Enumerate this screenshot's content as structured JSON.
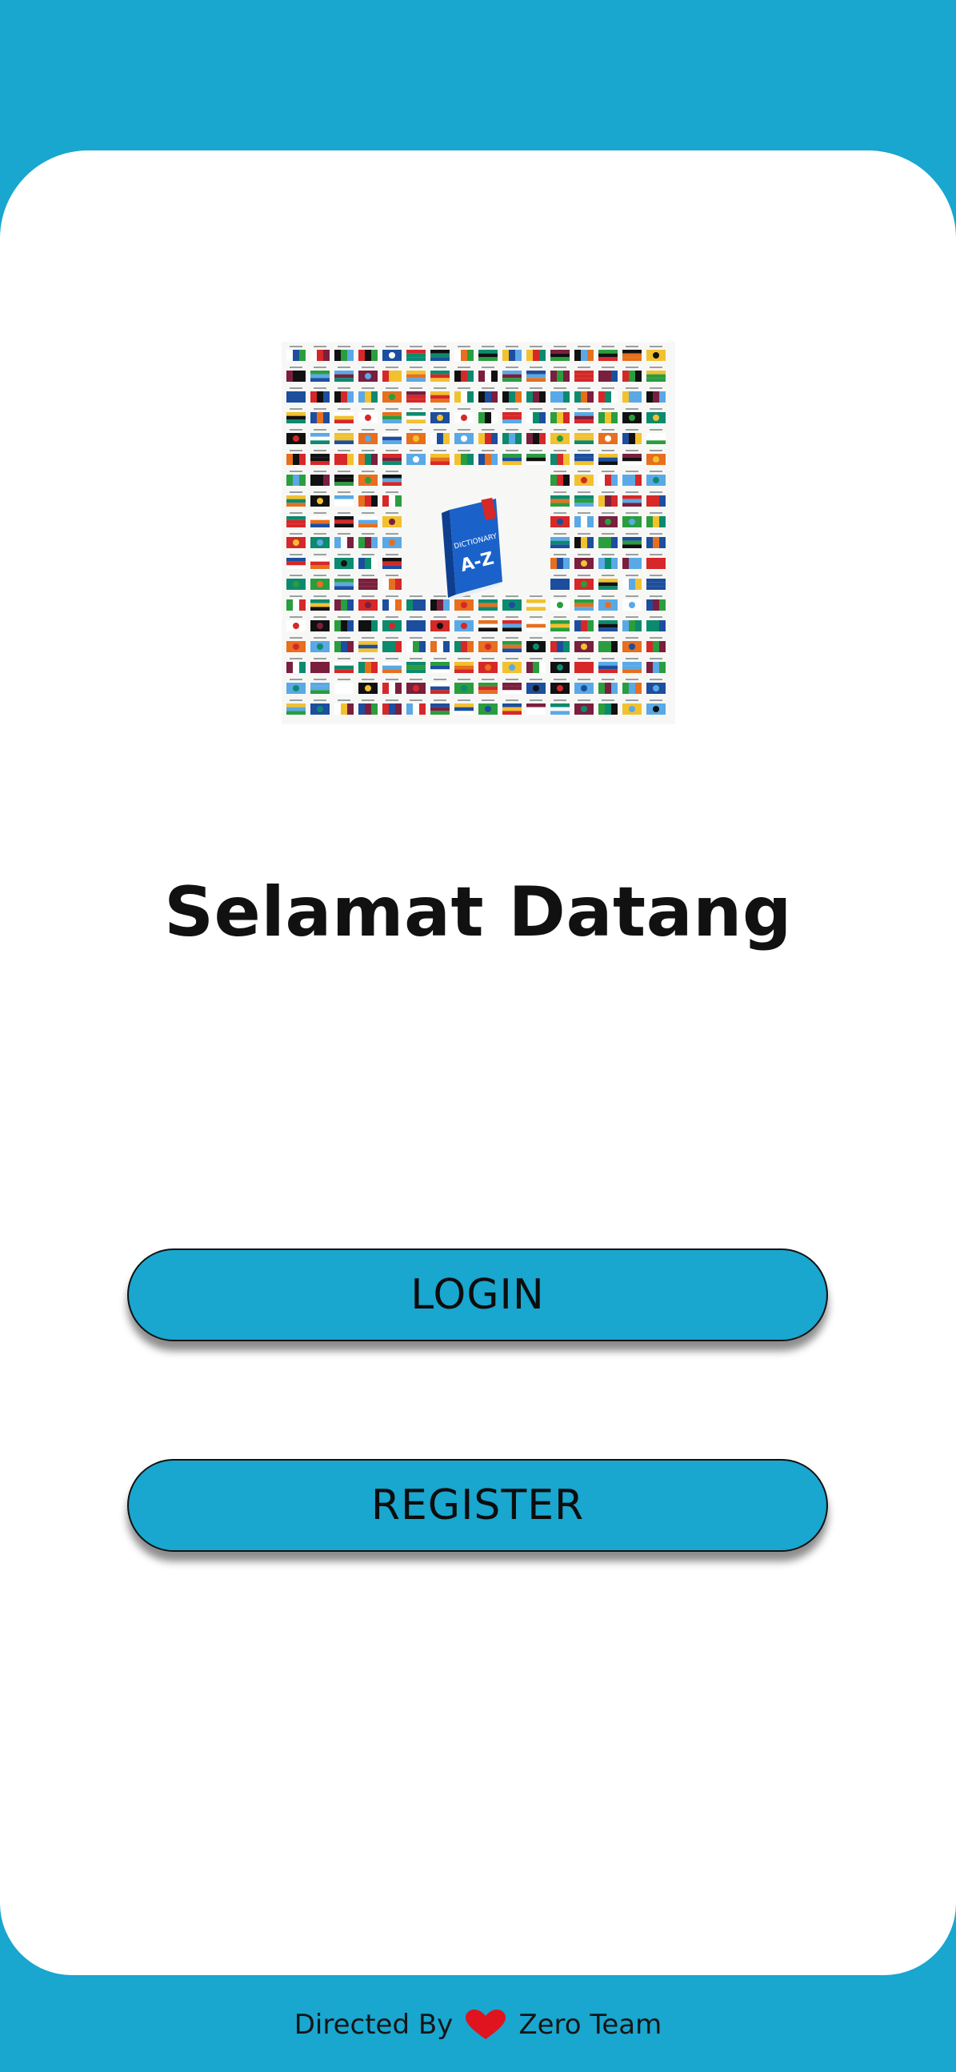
{
  "hero": {
    "image_name": "world-flags-dictionary-illustration",
    "book_label": "DICTIONARY",
    "book_title": "A-Z",
    "flag_colors": [
      "#d62828",
      "#1d4e9e",
      "#2a9d3f",
      "#f2c12e",
      "#111111",
      "#ffffff",
      "#e76f1e",
      "#5aa9e6",
      "#7a1f3d",
      "#0c8a6e"
    ]
  },
  "title": "Selamat Datang",
  "buttons": {
    "login": "LOGIN",
    "register": "REGISTER"
  },
  "footer": {
    "prefix": "Directed By",
    "icon": "heart-icon",
    "team": "Zero Team"
  },
  "colors": {
    "background": "#19a6cf",
    "card": "#ffffff",
    "button": "#19a6cf",
    "heart": "#e0141e"
  }
}
